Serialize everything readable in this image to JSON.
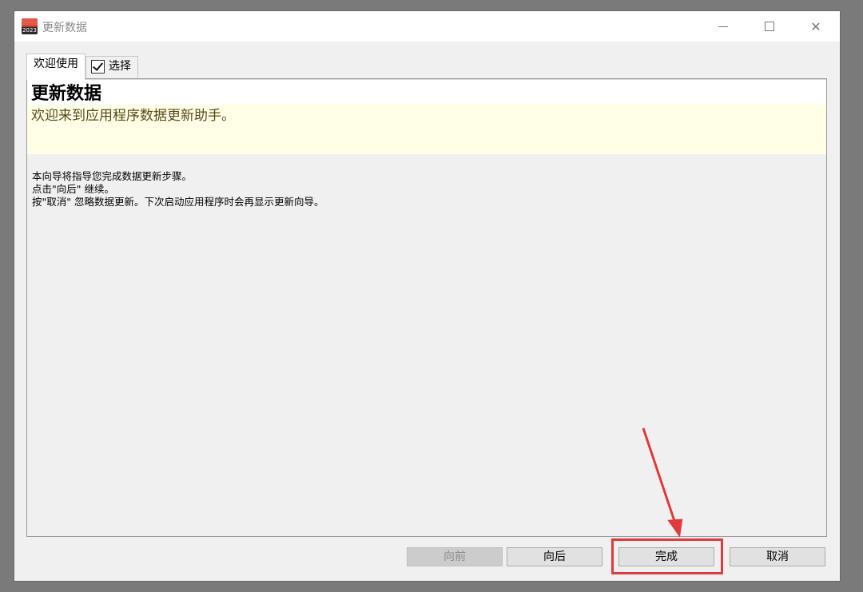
{
  "window": {
    "title": "更新数据",
    "app_icon_year": "2023",
    "controls": [
      "minimize-icon",
      "maximize-icon",
      "close-icon"
    ]
  },
  "tabs": [
    {
      "label": "欢迎使用",
      "active": true
    },
    {
      "label": "选择",
      "checked": true
    }
  ],
  "header": {
    "title": "更新数据",
    "subtitle": "欢迎来到应用程序数据更新助手。"
  },
  "body": {
    "lines": [
      "本向导将指导您完成数据更新步骤。",
      "点击\"向后\" 继续。",
      "按\"取消\" 忽略数据更新。下次启动应用程序时会再显示更新向导。"
    ]
  },
  "buttons": {
    "prev": "向前",
    "next": "向后",
    "finish": "完成",
    "cancel": "取消"
  },
  "colors": {
    "annotation": "#e0393e",
    "header_bg": "#ffffe8",
    "disabled_button": "#cccccc"
  }
}
